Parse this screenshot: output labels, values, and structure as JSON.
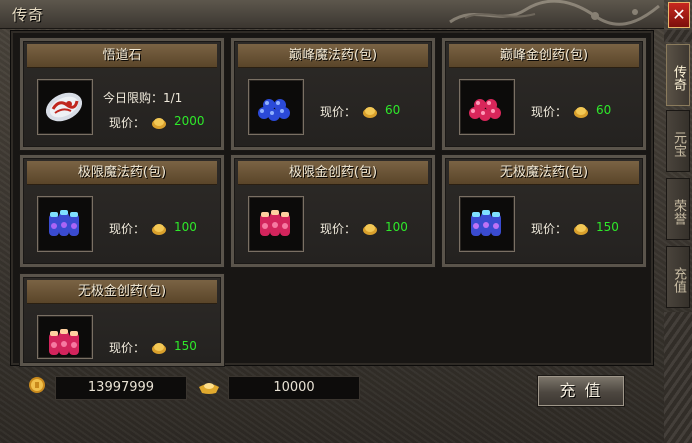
{
  "window": {
    "title": "传奇",
    "close_symbol": "✕"
  },
  "side_tabs": [
    {
      "label": "传奇",
      "active": true
    },
    {
      "label": "元宝",
      "active": false
    },
    {
      "label": "荣誉",
      "active": false
    },
    {
      "label": "充值",
      "active": false
    }
  ],
  "items": [
    {
      "name": "悟道石",
      "limit": "今日限购：1/1",
      "price_label": "现价：",
      "price": "2000",
      "icon": "stone-icon"
    },
    {
      "name": "巅峰魔法药(包)",
      "price_label": "现价：",
      "price": "60",
      "icon": "blue-potion-pack-icon"
    },
    {
      "name": "巅峰金创药(包)",
      "price_label": "现价：",
      "price": "60",
      "icon": "red-potion-pack-icon"
    },
    {
      "name": "极限魔法药(包)",
      "price_label": "现价：",
      "price": "100",
      "icon": "blue-potion-pack-icon"
    },
    {
      "name": "极限金创药(包)",
      "price_label": "现价：",
      "price": "100",
      "icon": "red-potion-pack-icon"
    },
    {
      "name": "无极魔法药(包)",
      "price_label": "现价：",
      "price": "150",
      "icon": "blue-potion-pack-icon"
    },
    {
      "name": "无极金创药(包)",
      "price_label": "现价：",
      "price": "150",
      "icon": "red-potion-pack-icon"
    }
  ],
  "currency": {
    "gold": "13997999",
    "yuanbao": "10000"
  },
  "buttons": {
    "recharge": "充 值"
  },
  "colors": {
    "price_green": "#2ee82a",
    "header_brown": "#6b5436",
    "close_red": "#b5231b"
  }
}
